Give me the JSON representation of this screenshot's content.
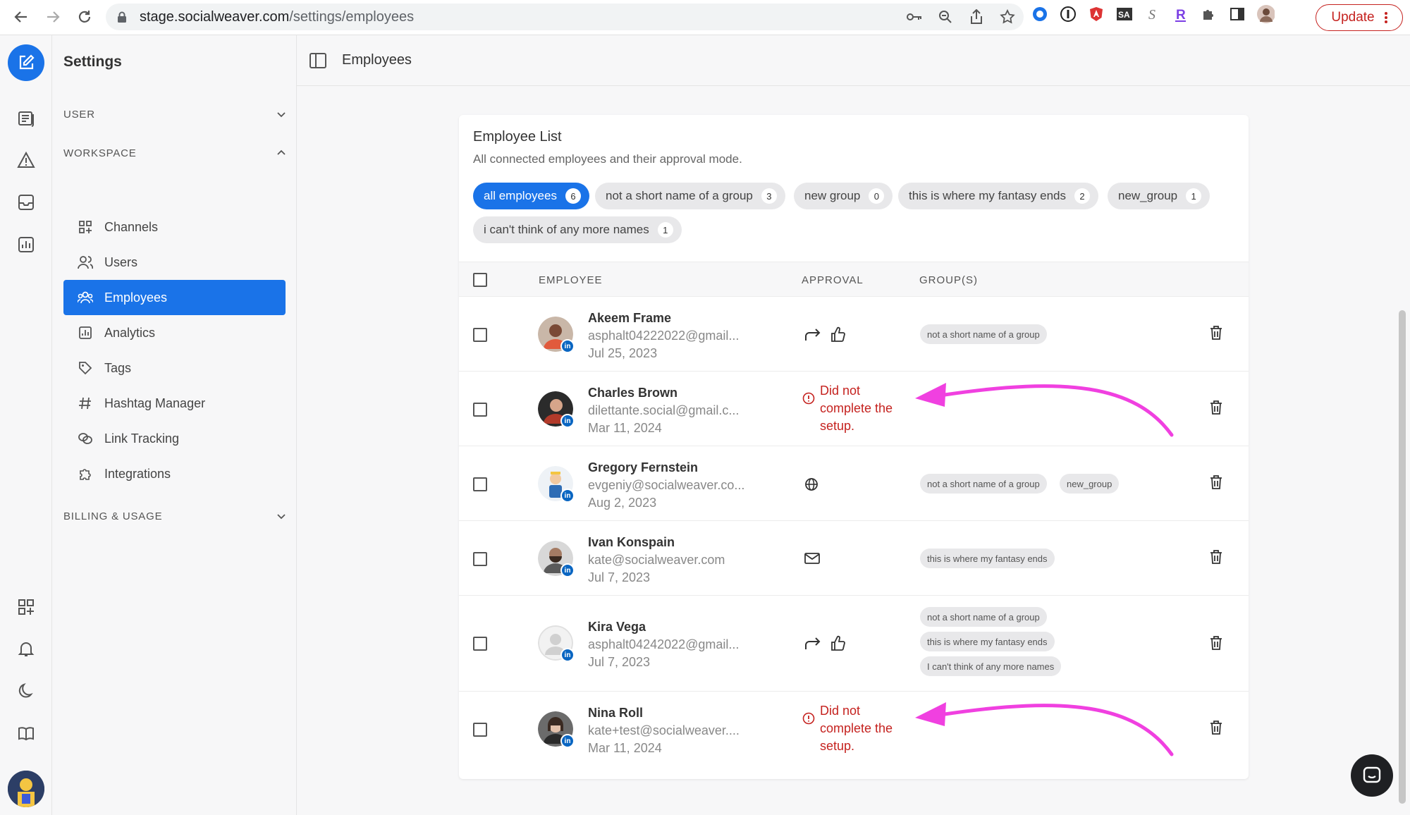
{
  "browser": {
    "url_host": "stage.socialweaver.com",
    "url_path": "/settings/employees",
    "update_label": "Update"
  },
  "sidebar": {
    "title": "Settings",
    "sections": {
      "user": "USER",
      "workspace": "WORKSPACE",
      "billing": "BILLING & USAGE"
    },
    "items": [
      {
        "label": "Channels",
        "icon": "grid-plus-icon"
      },
      {
        "label": "Users",
        "icon": "users-icon"
      },
      {
        "label": "Employees",
        "icon": "employees-icon",
        "active": true
      },
      {
        "label": "Analytics",
        "icon": "analytics-icon"
      },
      {
        "label": "Tags",
        "icon": "tag-icon"
      },
      {
        "label": "Hashtag Manager",
        "icon": "hashtag-icon"
      },
      {
        "label": "Link Tracking",
        "icon": "link-icon"
      },
      {
        "label": "Integrations",
        "icon": "puzzle-icon"
      }
    ]
  },
  "header": {
    "title": "Employees"
  },
  "card": {
    "title": "Employee List",
    "subtitle": "All connected employees and their approval mode.",
    "chips": [
      {
        "label": "all employees",
        "count": "6",
        "active": true
      },
      {
        "label": "not a short name of a group",
        "count": "3"
      },
      {
        "label": "new group",
        "count": "0"
      },
      {
        "label": "this is where my fantasy ends",
        "count": "2"
      },
      {
        "label": "new_group",
        "count": "1"
      },
      {
        "label": "i can't think of any more names",
        "count": "1"
      }
    ],
    "columns": {
      "employee": "EMPLOYEE",
      "approval": "APPROVAL",
      "groups": "GROUP(S)"
    }
  },
  "employees": [
    {
      "name": "Akeem Frame",
      "email": "asphalt04222022@gmail...",
      "date": "Jul 25, 2023",
      "approval": "forward-approve",
      "groups": [
        "not a short name of a group"
      ]
    },
    {
      "name": "Charles Brown",
      "email": "dilettante.social@gmail.c...",
      "date": "Mar 11, 2024",
      "approval": "warning",
      "warning_text": "Did not complete the setup.",
      "groups": []
    },
    {
      "name": "Gregory Fernstein",
      "email": "evgeniy@socialweaver.co...",
      "date": "Aug 2, 2023",
      "approval": "globe",
      "groups": [
        "not a short name of a group",
        "new_group"
      ]
    },
    {
      "name": "Ivan Konspain",
      "email": "kate@socialweaver.com",
      "date": "Jul 7, 2023",
      "approval": "mail",
      "groups": [
        "this is where my fantasy ends"
      ]
    },
    {
      "name": "Kira Vega",
      "email": "asphalt04242022@gmail...",
      "date": "Jul 7, 2023",
      "approval": "forward-approve",
      "groups": [
        "not a short name of a group",
        "this is where my fantasy ends",
        "I can't think of any more names"
      ]
    },
    {
      "name": "Nina Roll",
      "email": "kate+test@socialweaver....",
      "date": "Mar 11, 2024",
      "approval": "warning",
      "warning_text": "Did not complete the setup.",
      "groups": []
    }
  ],
  "colors": {
    "accent": "#1a73e8",
    "warning": "#c5221f",
    "annotation_arrow": "#f040e0"
  }
}
